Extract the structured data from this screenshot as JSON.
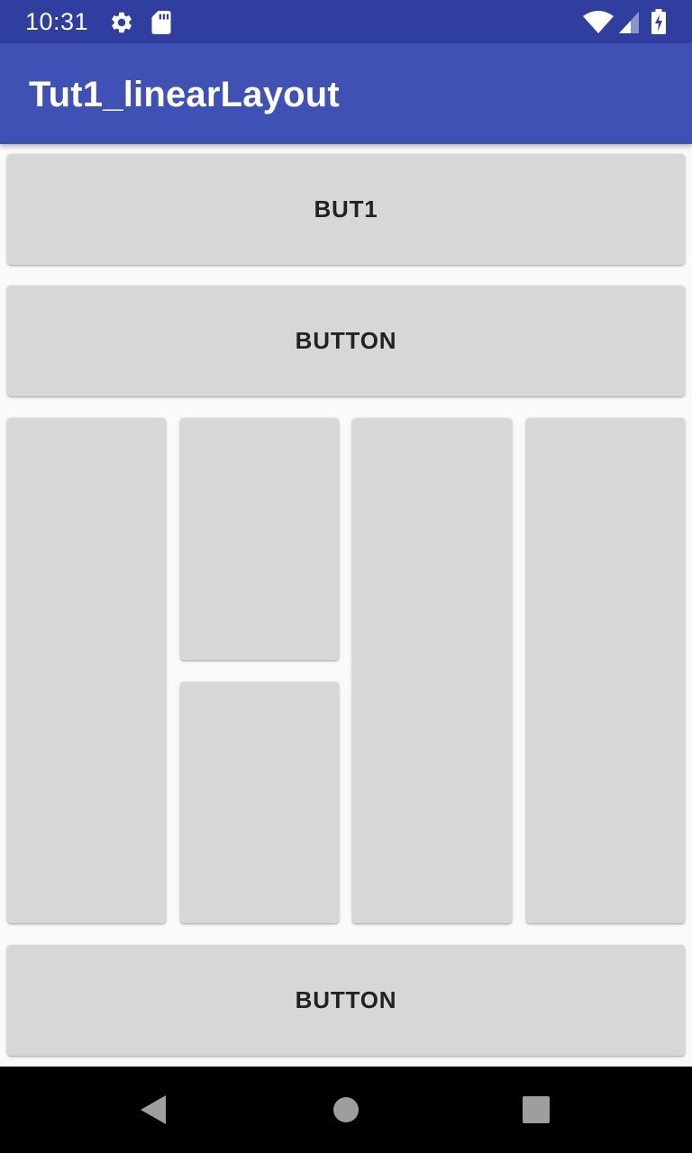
{
  "status_bar": {
    "time": "10:31",
    "icons": [
      "gear-icon",
      "sd-card-icon",
      "wifi-icon",
      "cell-signal-icon",
      "battery-charging-icon"
    ],
    "color": "#303f9f"
  },
  "app_bar": {
    "title": "Tut1_linearLayout",
    "color": "#3f51b5"
  },
  "buttons": {
    "top": "BUT1",
    "second": "BUTTON",
    "columns": [
      "",
      "",
      "",
      "",
      ""
    ],
    "bottom": "BUTTON"
  },
  "nav_bar": {
    "icons": [
      "back-icon",
      "home-icon",
      "recents-icon"
    ]
  }
}
